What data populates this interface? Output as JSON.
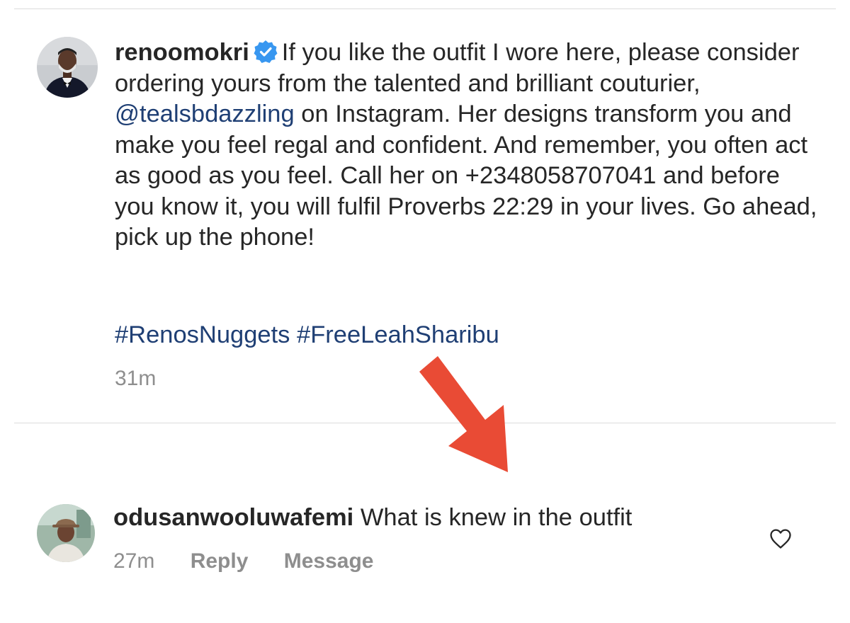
{
  "post": {
    "username": "renoomokri",
    "caption_part1": "If you like the outfit I wore here, please consider ordering yours from the talented and brilliant couturier, ",
    "mention": "@tealsbdazzling",
    "caption_part2": " on Instagram. Her designs transform you and make you feel regal and confident. And remember, you often act as good as you feel. Call her on +2348058707041 and before you know it, you will fulfil Proverbs 22:29 in your lives. Go ahead, pick up the phone!",
    "hashtags": [
      "#RenosNuggets",
      "#FreeLeahSharibu"
    ],
    "time": "31m",
    "icons": {
      "avatar": "avatar-photo",
      "badge": "verified-badge-icon"
    }
  },
  "comment": {
    "username": "odusanwooluwafemi",
    "text": " What is knew in the outfit",
    "time": "27m",
    "reply_label": "Reply",
    "message_label": "Message",
    "icons": {
      "avatar": "avatar-photo",
      "like": "heart-outline-icon"
    }
  },
  "annotation": {
    "type": "arrow",
    "color": "#e94b35"
  },
  "colors": {
    "link": "#1f3f74",
    "muted": "#8e8e8e",
    "text": "#262626",
    "divider": "#dbdbdb"
  }
}
